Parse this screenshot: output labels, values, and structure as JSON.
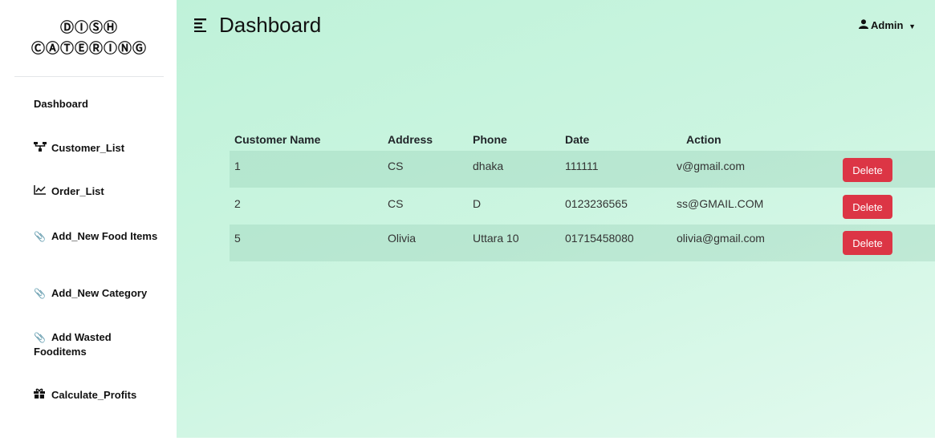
{
  "brand": {
    "line1": "ⒹⒾⓈⒽ",
    "line2": "ⒸⒶⓉⒺⓇⒾⓃⒼ"
  },
  "sidebar": {
    "items": [
      {
        "label": "Dashboard",
        "icon": ""
      },
      {
        "label": "Customer_List",
        "icon": "sitemap-icon"
      },
      {
        "label": "Order_List",
        "icon": "chart-line-icon"
      },
      {
        "label": "Add_New Food Items",
        "icon": "paperclip-icon"
      },
      {
        "label": "Add_New Category",
        "icon": "paperclip-icon"
      },
      {
        "label": "Add Wasted Fooditems",
        "icon": "paperclip-icon"
      },
      {
        "label": "Calculate_Profits",
        "icon": "gift-icon"
      }
    ]
  },
  "header": {
    "title": "Dashboard",
    "user": "Admin"
  },
  "table": {
    "columns": [
      "Customer Name",
      "Address",
      "Phone",
      "Date",
      "Action"
    ],
    "rows": [
      {
        "c1": "1",
        "c2": "CS",
        "c3": "dhaka",
        "c4": "111111",
        "c5": "v@gmail.com",
        "action": "Delete"
      },
      {
        "c1": "2",
        "c2": "CS",
        "c3": "D",
        "c4": "0123236565",
        "c5": "ss@GMAIL.COM",
        "action": "Delete"
      },
      {
        "c1": "5",
        "c2": "Olivia",
        "c3": "Uttara 10",
        "c4": "01715458080",
        "c5": "olivia@gmail.com",
        "action": "Delete"
      }
    ]
  },
  "colors": {
    "accent_danger": "#dc3545",
    "main_bg": "#c8f4de"
  }
}
